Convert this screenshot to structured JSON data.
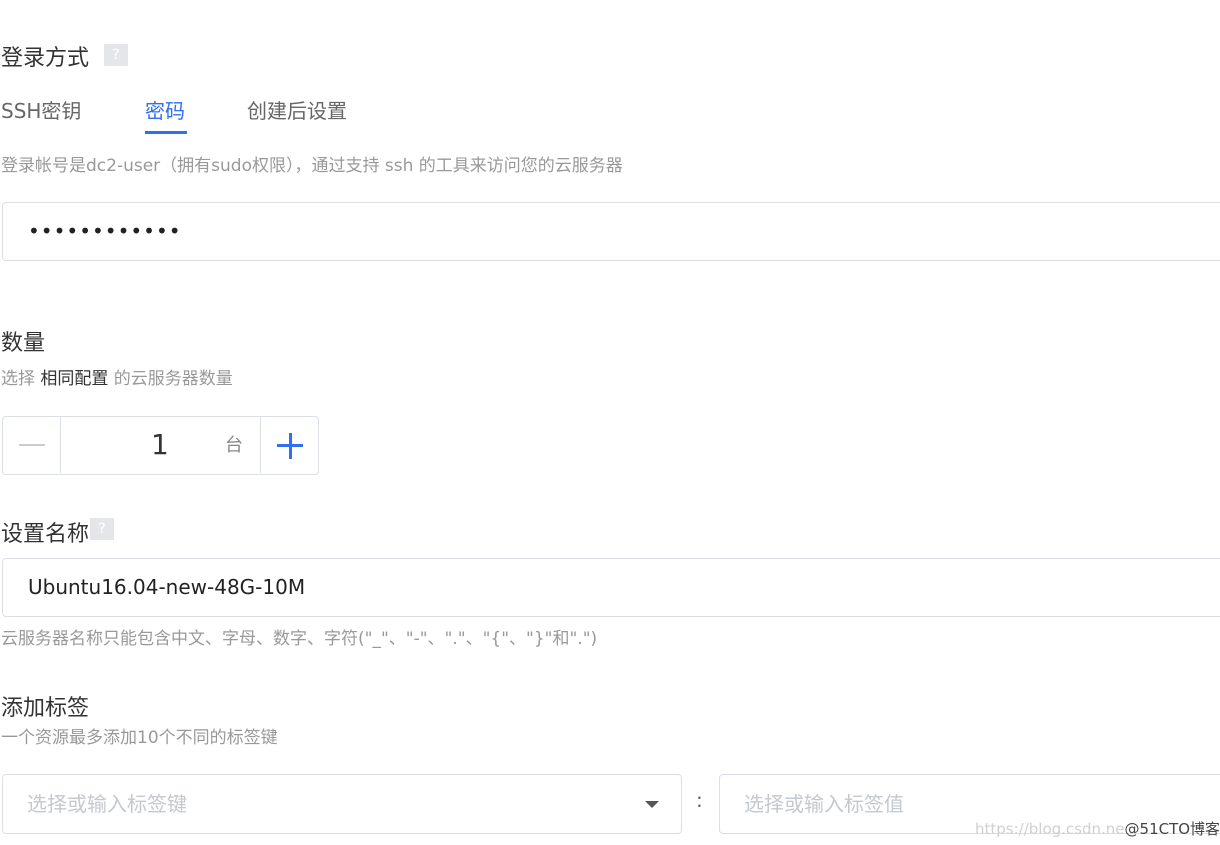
{
  "login": {
    "title": "登录方式",
    "help": "?",
    "tabs": [
      {
        "label": "SSH密钥",
        "active": false
      },
      {
        "label": "密码",
        "active": true
      },
      {
        "label": "创建后设置",
        "active": false
      }
    ],
    "description": "登录帐号是dc2-user（拥有sudo权限），通过支持 ssh 的工具来访问您的云服务器",
    "password_value": "••••••••••••"
  },
  "quantity": {
    "title": "数量",
    "desc_prefix": "选择 ",
    "desc_strong": "相同配置",
    "desc_suffix": " 的云服务器数量",
    "value": "1",
    "unit": "台"
  },
  "name": {
    "title": "设置名称",
    "help": "?",
    "value": "Ubuntu16.04-new-48G-10M",
    "hint": "云服务器名称只能包含中文、字母、数字、字符(\"_\"、\"-\"、\".\"、\"{\"、\"}\"和\".\")"
  },
  "tags": {
    "title": "添加标签",
    "description": "一个资源最多添加10个不同的标签键",
    "key_placeholder": "选择或输入标签键",
    "separator": ":",
    "value_placeholder": "选择或输入标签值"
  },
  "watermark": {
    "url": "https://blog.csdn.ne",
    "brand": "@51CTO博客"
  },
  "colors": {
    "accent": "#2f6ff0",
    "border": "#dcdfe6",
    "muted_text": "#999999"
  }
}
